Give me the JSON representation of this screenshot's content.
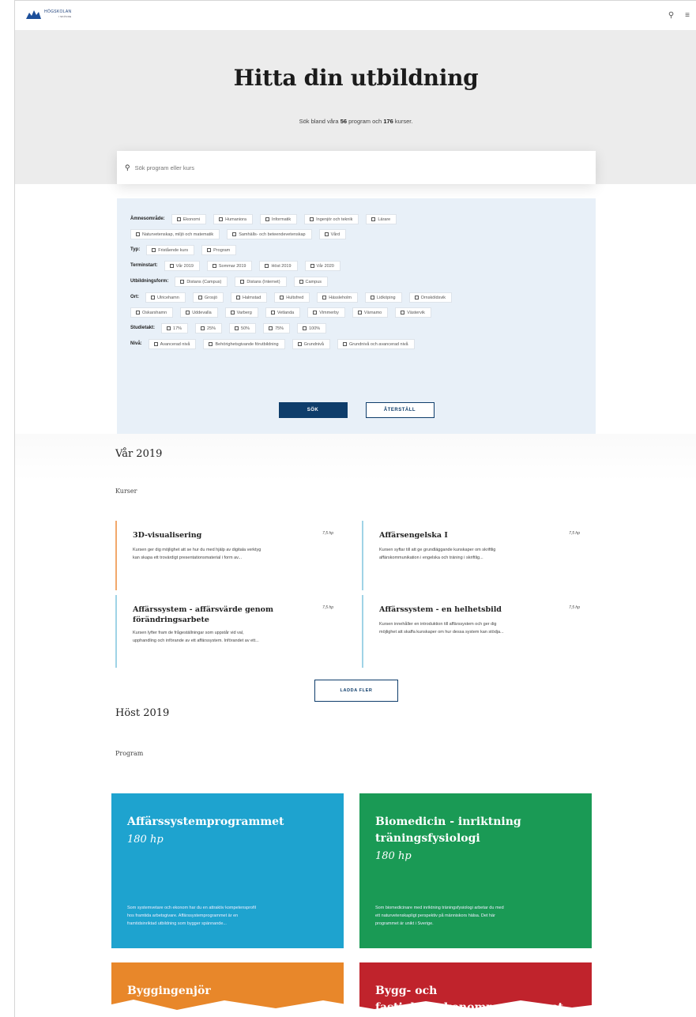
{
  "header": {
    "logo_name": "HÖGSKOLAN",
    "logo_sub": "I SKÖVDE",
    "search_icon": "search-icon",
    "menu_icon": "menu-icon"
  },
  "hero": {
    "title": "Hitta din utbildning",
    "intro_pre": "Sök bland våra ",
    "program_count": "56",
    "intro_mid": " program och ",
    "course_count": "176",
    "intro_post": " kurser."
  },
  "search": {
    "placeholder": "Sök program eller kurs"
  },
  "filters": {
    "amne": {
      "label": "Ämnesområde:",
      "options": [
        "Ekonomi",
        "Humaniora",
        "Informatik",
        "Ingenjör och teknik",
        "Lärare",
        "Naturvetenskap, miljö och matematik",
        "Samhälls- och beteendevetenskap",
        "Vård"
      ]
    },
    "typ": {
      "label": "Typ:",
      "options": [
        "Fristående kurs",
        "Program"
      ]
    },
    "terminstart": {
      "label": "Terminstart:",
      "options": [
        "Vår 2019",
        "Sommar 2019",
        "Höst 2019",
        "Vår 2020"
      ]
    },
    "utbildningsform": {
      "label": "Utbildningsform:",
      "options": [
        "Distans (Campus)",
        "Distans (Internet)",
        "Campus"
      ]
    },
    "ort": {
      "label": "Ort:",
      "options": [
        "Ulricehamn",
        "Grosjö",
        "Halmstad",
        "Hultsfred",
        "Hässleholm",
        "Lidköping",
        "Ornsköldsvik",
        "Oskarshamn",
        "Uddevalla",
        "Varberg",
        "Vetlanda",
        "Vimmerby",
        "Värnamo",
        "Västervik"
      ]
    },
    "studietakt": {
      "label": "Studietakt:",
      "options": [
        "17%",
        "25%",
        "50%",
        "75%",
        "100%"
      ]
    },
    "niva": {
      "label": "Nivå:",
      "options": [
        "Avancerad nivå",
        "Behörighetsgivande förutbildning",
        "Grundnivå",
        "Grundnivå och avancerad nivå"
      ]
    },
    "search_button": "SÖK",
    "reset_button": "ÅTERSTÄLL"
  },
  "spring": {
    "title": "Vår 2019",
    "subtitle": "Kurser",
    "courses": [
      {
        "title": "3D-visualisering",
        "hp": "7,5 hp",
        "desc1": "Kursen ger dig möjlighet att se hur du med hjälp av digitala verktyg",
        "desc2": "kan skapa ett trovärdigt presentationsmaterial i form av..."
      },
      {
        "title": "Affärsengelska I",
        "hp": "7,5 hp",
        "desc1": "Kursen syftar till att ge grundläggande kunskaper om skriftlig",
        "desc2": "affärskommunikation i engelska och träning i skriftlig..."
      },
      {
        "title": "Affärssystem - affärsvärde genom förändringsarbete",
        "hp": "7,5 hp",
        "desc1": "Kursen lyfter fram de frågeställningar som uppstår vid val,",
        "desc2": "upphandling och införande av ett affärssystem. Införandet av ett..."
      },
      {
        "title": "Affärssystem - en helhetsbild",
        "hp": "7,5 hp",
        "desc1": "Kursen innehåller en introduktion till affärssystem och ger dig",
        "desc2": "möjlighet att skaffa kunskaper om hur dessa system kan stödja..."
      }
    ],
    "load_more": "LADDA FLER"
  },
  "autumn": {
    "title": "Höst 2019",
    "subtitle": "Program",
    "programs": [
      {
        "title": "Affärssystemprogrammet",
        "hp": "180 hp",
        "desc1": "Som systemvetare och ekonom har du en attraktiv kompetensprofil",
        "desc2": "hos framtida arbetsgivare. Affärssystemprogrammet är en",
        "desc3": "framtidsinriktad utbildning som bygger spännande...",
        "color": "#1ea3cf"
      },
      {
        "title": "Biomedicin - inriktning träningsfysiologi",
        "hp": "180 hp",
        "desc1": "Som biomedicinare med inriktning träningsfysiologi arbetar du med",
        "desc2": "ett naturvetenskapligt perspektiv på människors hälsa. Det här",
        "desc3": "programmet är unikt i Sverige.",
        "color": "#1a9a55"
      },
      {
        "title": "Byggingenjör",
        "color": "#e8872a"
      },
      {
        "title": "Bygg- och fastighetsekonomprogrammet",
        "color": "#c0232c"
      }
    ]
  }
}
